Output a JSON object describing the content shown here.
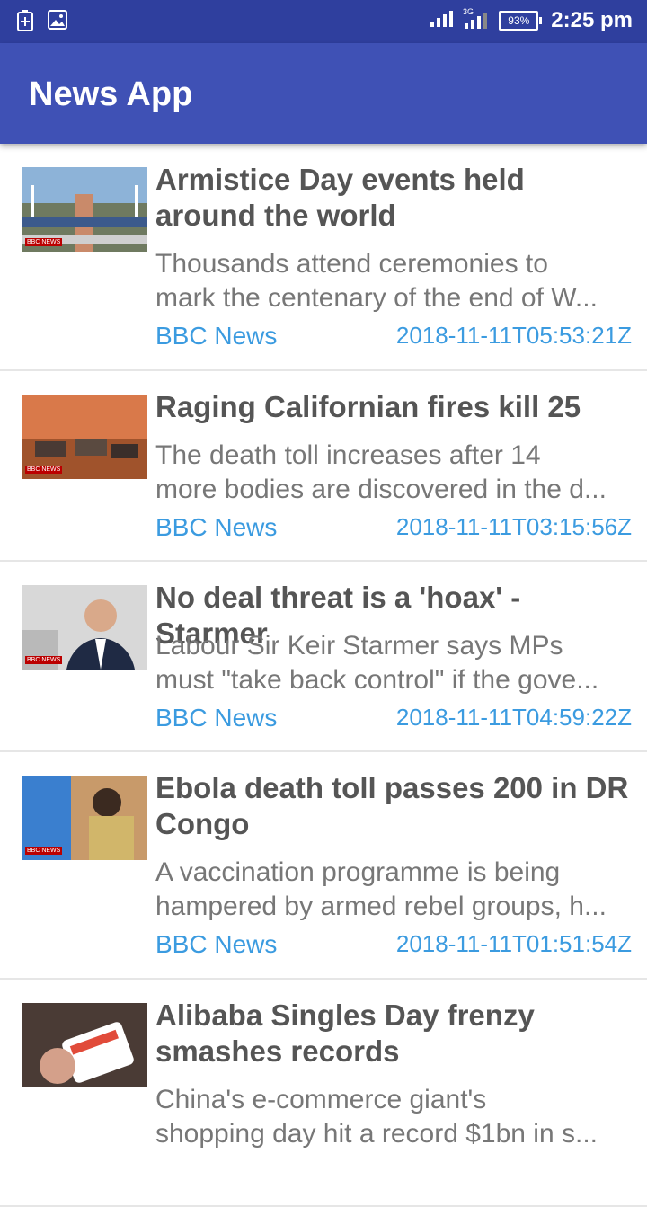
{
  "status_bar": {
    "battery": "93%",
    "time": "2:25 pm",
    "network": "3G"
  },
  "app": {
    "title": "News App"
  },
  "articles": [
    {
      "title": "Armistice Day events held around the world",
      "description": [
        "Thousands attend ceremonies to",
        "mark the centenary of the end of W..."
      ],
      "source": "BBC News",
      "published": "2018-11-11T05:53:21Z",
      "thumbnail_icon": "armistice-photo"
    },
    {
      "title": "Raging Californian fires kill 25",
      "description": [
        "The death toll increases after 14",
        "more bodies are discovered in the d..."
      ],
      "source": "BBC News",
      "published": "2018-11-11T03:15:56Z",
      "thumbnail_icon": "fire-photo"
    },
    {
      "title": "No deal threat is a 'hoax' - Starmer",
      "description": [
        "Labour Sir Keir Starmer says MPs",
        "must \"take back control\" if the gove..."
      ],
      "source": "BBC News",
      "published": "2018-11-11T04:59:22Z",
      "thumbnail_icon": "starmer-photo"
    },
    {
      "title": "Ebola death toll passes 200 in DR Congo",
      "description": [
        "A vaccination programme is being",
        "hampered by armed rebel groups, h..."
      ],
      "source": "BBC News",
      "published": "2018-11-11T01:51:54Z",
      "thumbnail_icon": "ebola-photo"
    },
    {
      "title": "Alibaba Singles Day frenzy smashes records",
      "description": [
        "China's e-commerce giant's",
        "shopping day hit a record $1bn in s..."
      ],
      "source": "",
      "published": "",
      "thumbnail_icon": "alibaba-photo"
    }
  ],
  "thumbnail_badge": "BBC NEWS",
  "colors": {
    "status_bar": "#2f3f9e",
    "app_bar": "#3f51b5",
    "accent_text": "#3b9be0"
  }
}
